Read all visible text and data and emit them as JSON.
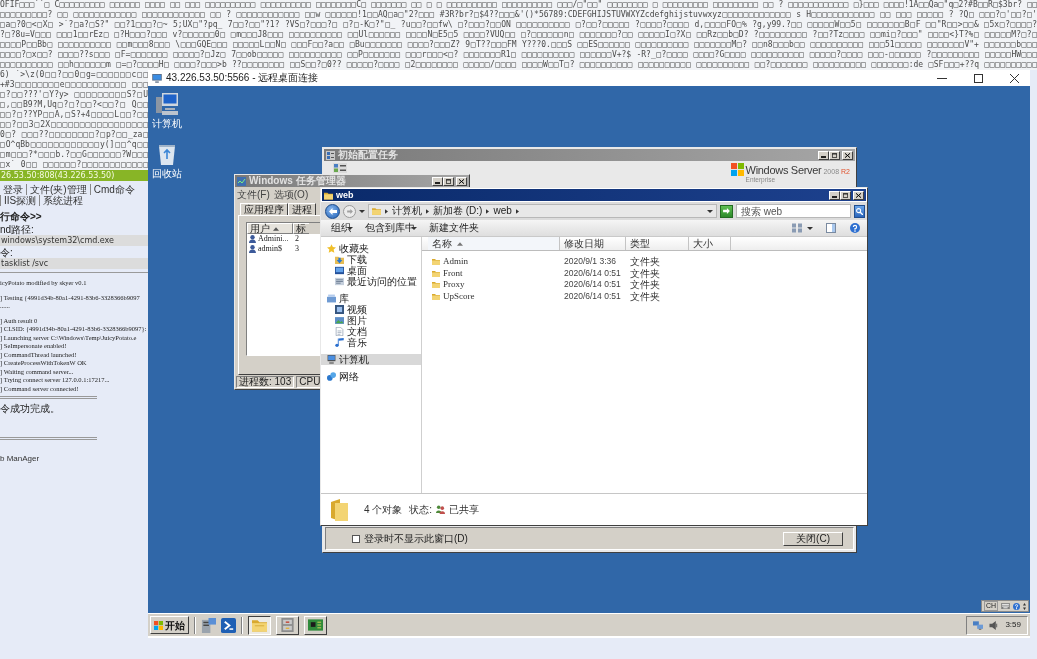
{
  "web_page": {
    "dump_lines": [
      "OFIF□□□``□ C□□□□□□□□□ □□□□□□ □□□□ □□ □□□ □□□□□□□□□□ □□□□□□□□□□ □□□□□□□□C□ □□□□□□□ □□ □ □ □□□□□□□□□□ □□□□□□□□□□ □□□/□\"□□\" □□□□□□□□ □ □□□□□□□□□ □□□□□□□□□ □□ ? □□□□□□□□□□□□ □}□□□ □□□□!1A□□Qa□\"q□2?#B□□R□$3br? □□",
      "□□□□□□□□□? □□ □□□□□□□□□□□□ □□□□□□□□□□□□ □□ ? □□□□□□□□□□□□ □□w □□□□□□!1□□AQ□a□\"2?□□□ #3R?br?□$4??□□□&'()*56789:CDEFGHIJSTUVWXYZcdefghijstuvwxyz□□□□□□□□□□□□□ s H□□□□□□□□□□□□ □□ □□□ □□□□□ ? ?Q□ □□□?□'□□?□'",
      "□a□?0□<□X□ >`?□a?□S?\" □□?1□□□?□~ 5;UX□\"?pq_ 7□□?□□\"?1? ?VS□?□□□?□ □?□-K□?\"□_ ?u□□?□□fw\\ □?□□□?□□ON □□□□□□□□□□ □?□□?□□□□□ ?□□□□?□□□□ d,□□□□FO□% ?g,y99.?□□ □□□□□W□□5□ □□□□□□□B□F □□\"R□□>□□& □5x□?□□□□?",
      "?□?8u=V□□□ □□□1□□rEz□ □?H□□□?□□□ v?□□□□□□0□ □m□□□J8□□□ □□□□□□□□□□ □□Ul□□□□□□ □□□□N□E5□5 □□□□?VUQ□□ □?□□□□□□n□ □□□□□□□?□□ □□□□□I□?X□ □□Rz□□b□D? ?□□□□□□□□□ ?□□?Tz□□□□ □□mi□?□□□\" □□□□<}T?%□ □□□□□M?□?□",
      "□□□□P□□Bb□ □□□□□□□□□□ □□m□□□8□□□ \\□□□GQE□□□ □□□□□L□□N□ □□□F□□?a□□ □Bu□□□□□□□ □□□□?□□□Z? 9□T??□□□FM Y???0.□□□S □□ES□□□□□□ □□□□□□□□□□ □□□□□□□M□? □□n8□□□b□□ □□□□□□□□□□ □□□51□□□□□ □□□□□□□V\"+ □□□□□□b□□□",
      "□□□□?□x□□? □□□□??s□□□ □F=□□□□□□□ □□□□□?□Jz□ 7□□ob□□□□□ □□□□□□□□□□ □□P□□□□□□□ □□□r□□□<□? □□□□□□□R1□ □□□□□□□□□□ □□□□□□V+?$ -R?_□?□□□□ □□□□?G□□□□ □□□□□□□□□□ □□□□□?□□□□ □□□-□□□□□□ ?□□□□□□□□□ □□□□□HW□□□",
      "□□□□□□□□□□ □□h□□□□□□m □=□?□□□□H□ □□□□?□□□>b ??□□□□□□□□ □□S□□?□0?? □□□□□?□□□□ □2□□□□□□□□ □□□□□/□□□□ □□□□W□□T□? □□□□□□□□□□ □□□□□□□□□□ □□□□□□□□□□ □□?□□□□□□□ □□□□□□□□□□ □□□□□□□:de □SF□□□+??q □□□□□□□□□□"
    ],
    "side_dump_lines": [
      "6) `>\\z(0□□?□□0□g=□□□□□□c□□",
      "+#3□□□□□□□□e□□□□□□□□□□□ □□□",
      "□?□□???'□Y?y> □□□□□□□□□S?□U",
      "□,□□B9?M,Uq□?□?□□?<□□?□ Q□□",
      "□□?□??YP□□A,□S?+4□□□□L□□?□□",
      "□□?□□3□2X□□□□□□□□□□□□□□□□□",
      "0□? □□□??□□□□□□□□?□p?□□_za□",
      "□O^qBb□□□□□□□□□□□□y(]□□^q□□",
      "□m□□□?*□□□b.?□□G□□□□□□?W□□□",
      "□x` 0□□ □□□□□□?□□□□□□□□□□□□"
    ],
    "host_bar": "26.53.50:808(43.226.53.50)",
    "nav_links": [
      "登录",
      "文件(夹)管理",
      "Cmd命令",
      "IIS探测",
      "系统进程"
    ],
    "section_title": "行命令>>",
    "cmd_path": {
      "label": "nd路径:",
      "value": "windows\\system32\\cmd.exe"
    },
    "command": {
      "label": "令:",
      "value": "tasklist /svc"
    },
    "output_blocks": [
      [
        "icyPotato modified by skyer v0.1"
      ],
      [
        "] Testing {4991d34b-80a1-4291-83b6-3328366b9097",
        "......"
      ],
      [
        "] Auth result 0",
        "] CLSID: {4991d34b-80a1-4291-83b6-3328366b9097}:",
        "] Launching server C:\\Windows\\Temp\\JuicyPotato.e",
        "] SeImpersonate enabled!",
        "] CommandThread launched!",
        "] CreateProcessWithTokenW OK",
        "] Waiting command server...",
        "] Trying connect server 127.0.0.1:17217...",
        "] Command server connected!"
      ]
    ],
    "result": "令成功完成。",
    "footer": "b ManAger"
  },
  "remote_desktop": {
    "title": "43.226.53.50:5566 - 远程桌面连接",
    "desktop_icons": [
      {
        "label": "计算机",
        "kind": "computer"
      },
      {
        "label": "回收站",
        "kind": "recycle-bin"
      }
    ],
    "config_window": {
      "title": "初始配置任务",
      "logo": {
        "name": "Windows Server",
        "version": "2008",
        "release": "R2",
        "edition": "Enterprise"
      },
      "checkbox": {
        "label": "登录时不显示此窗口(D)",
        "checked": false
      },
      "close_button": "关闭(C)"
    },
    "task_manager": {
      "title": "Windows 任务管理器",
      "menu": [
        "文件(F)",
        "选项(O)"
      ],
      "tabs": [
        {
          "label": "应用程序",
          "selected": false
        },
        {
          "label": "进程",
          "selected": false
        }
      ],
      "columns": [
        {
          "label": "用户",
          "sorted": true
        },
        {
          "label": "标",
          "sorted": false
        }
      ],
      "rows": [
        {
          "user": "Admini...",
          "id": "2"
        },
        {
          "user": "admin$",
          "id": "3"
        }
      ],
      "status": [
        "进程数: 103",
        "CPU"
      ]
    },
    "explorer": {
      "title": "web",
      "breadcrumb": [
        "计算机",
        "新加卷 (D:)",
        "web"
      ],
      "search": {
        "placeholder": "搜索 web"
      },
      "toolbar": [
        {
          "label": "组织",
          "dropdown": true
        },
        {
          "label": "包含到库中",
          "dropdown": true
        },
        {
          "label": "新建文件夹",
          "dropdown": false
        }
      ],
      "nav": [
        {
          "label": "收藏夹",
          "kind": "favorites",
          "selected": false,
          "children": [
            {
              "label": "下载",
              "kind": "downloads",
              "selected": false
            },
            {
              "label": "桌面",
              "kind": "desktop",
              "selected": false
            },
            {
              "label": "最近访问的位置",
              "kind": "recent",
              "selected": false
            }
          ]
        },
        {
          "label": "库",
          "kind": "libraries",
          "selected": false,
          "children": [
            {
              "label": "视频",
              "kind": "videos",
              "selected": false
            },
            {
              "label": "图片",
              "kind": "pictures",
              "selected": false
            },
            {
              "label": "文档",
              "kind": "documents",
              "selected": false
            },
            {
              "label": "音乐",
              "kind": "music",
              "selected": false
            }
          ]
        },
        {
          "label": "计算机",
          "kind": "computer",
          "selected": true
        },
        {
          "label": "网络",
          "kind": "network",
          "selected": false
        }
      ],
      "columns": [
        {
          "label": "名称",
          "sorted": true
        },
        {
          "label": "修改日期",
          "sorted": false
        },
        {
          "label": "类型",
          "sorted": false
        },
        {
          "label": "大小",
          "sorted": false
        }
      ],
      "files": [
        {
          "name": "Admin",
          "modified": "2020/9/1 3:36",
          "type": "文件夹"
        },
        {
          "name": "Front",
          "modified": "2020/6/14 0:51",
          "type": "文件夹"
        },
        {
          "name": "Proxy",
          "modified": "2020/6/14 0:51",
          "type": "文件夹"
        },
        {
          "name": "UpScore",
          "modified": "2020/6/14 0:51",
          "type": "文件夹"
        }
      ],
      "details": {
        "count": "4 个对象",
        "status_label": "状态:",
        "status": "已共享"
      }
    },
    "language_bar": {
      "language": "CH"
    },
    "taskbar": {
      "start": "开始",
      "quick_launch": [
        {
          "kind": "server-manager"
        },
        {
          "kind": "powershell"
        }
      ],
      "windows": [
        {
          "kind": "explorer",
          "selected": true
        },
        {
          "kind": "archive",
          "selected": false
        },
        {
          "kind": "board",
          "selected": false
        }
      ],
      "clock": "3:59"
    }
  }
}
